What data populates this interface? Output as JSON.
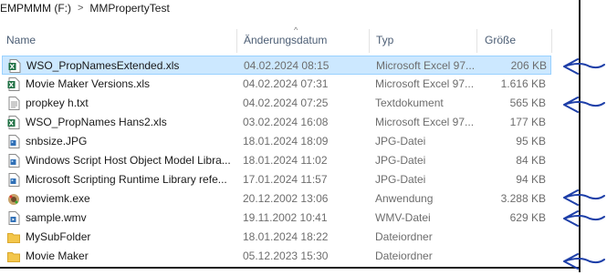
{
  "breadcrumb": {
    "drive": "EMPMMM (F:)",
    "separator": ">",
    "folder": "MMPropertyTest"
  },
  "columns": {
    "name": "Name",
    "date": "Änderungsdatum",
    "type": "Typ",
    "size": "Größe"
  },
  "sort_indicator": "^",
  "files": [
    {
      "name": "WSO_PropNamesExtended.xls",
      "date": "04.02.2024 08:15",
      "type": "Microsoft Excel 97...",
      "size": "206 KB",
      "icon": "excel-file-icon",
      "selected": true
    },
    {
      "name": "Movie Maker Versions.xls",
      "date": "04.02.2024 07:31",
      "type": "Microsoft Excel 97...",
      "size": "1.616 KB",
      "icon": "excel-file-icon",
      "selected": false
    },
    {
      "name": "propkey h.txt",
      "date": "04.02.2024 07:25",
      "type": "Textdokument",
      "size": "565 KB",
      "icon": "text-file-icon",
      "selected": false
    },
    {
      "name": "WSO_PropNames Hans2.xls",
      "date": "03.02.2024 16:08",
      "type": "Microsoft Excel 97...",
      "size": "177 KB",
      "icon": "excel-file-icon",
      "selected": false
    },
    {
      "name": "snbsize.JPG",
      "date": "18.01.2024 18:09",
      "type": "JPG-Datei",
      "size": "95 KB",
      "icon": "image-file-icon",
      "selected": false
    },
    {
      "name": "Windows Script Host Object Model  Libra...",
      "date": "18.01.2024 11:02",
      "type": "JPG-Datei",
      "size": "84 KB",
      "icon": "image-file-icon",
      "selected": false
    },
    {
      "name": "Microsoft Scripting Runtime  Library refe...",
      "date": "17.01.2024 11:57",
      "type": "JPG-Datei",
      "size": "94 KB",
      "icon": "image-file-icon",
      "selected": false
    },
    {
      "name": "moviemk.exe",
      "date": "20.12.2002 13:06",
      "type": "Anwendung",
      "size": "3.288 KB",
      "icon": "application-icon",
      "selected": false
    },
    {
      "name": "sample.wmv",
      "date": "19.11.2002 10:41",
      "type": "WMV-Datei",
      "size": "629 KB",
      "icon": "video-file-icon",
      "selected": false
    },
    {
      "name": "MySubFolder",
      "date": "18.01.2024 18:22",
      "type": "Dateiordner",
      "size": "",
      "icon": "folder-icon",
      "selected": false
    },
    {
      "name": "Movie Maker",
      "date": "05.12.2023 15:30",
      "type": "Dateiordner",
      "size": "",
      "icon": "folder-icon",
      "selected": false
    }
  ],
  "annotations": [
    {
      "name": "annotation-arrow-row-1"
    },
    {
      "name": "annotation-arrow-row-3"
    },
    {
      "name": "annotation-arrow-row-8"
    },
    {
      "name": "annotation-arrow-row-9"
    },
    {
      "name": "annotation-arrow-row-11"
    }
  ],
  "colors": {
    "selection": "#cce8ff",
    "selection_border": "#99d1ff",
    "header_text": "#4b5d74",
    "annotation_ink": "#1e3fa8",
    "folder": "#f3c64b",
    "excel": "#1d6f42",
    "image": "#2f6fb6"
  }
}
